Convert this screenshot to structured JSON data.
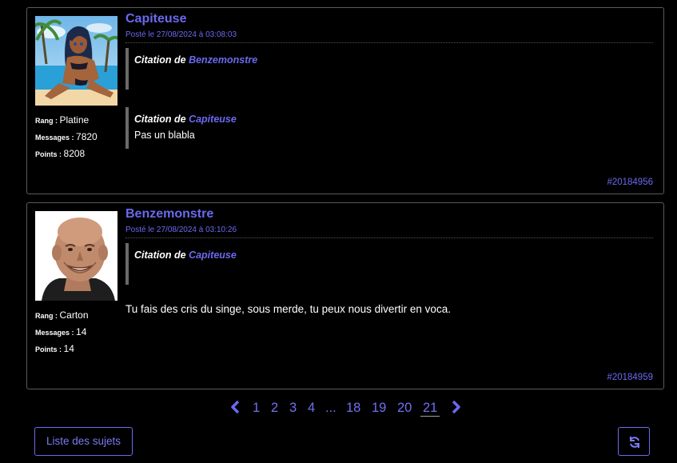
{
  "posts": [
    {
      "author": "Capiteuse",
      "date": "Posté le 27/08/2024 à 03:08:03",
      "stats": {
        "rank_label": "Rang",
        "rank": "Platine",
        "messages_label": "Messages",
        "messages": "7820",
        "points_label": "Points",
        "points": "8208"
      },
      "quotes": [
        {
          "prefix": "Citation de ",
          "author": "Benzemonstre",
          "text": ""
        },
        {
          "prefix": "Citation de ",
          "author": "Capiteuse",
          "text": "Pas un blabla"
        }
      ],
      "text": "",
      "id": "#20184956",
      "avatar_icon": "anime-girl-beach-avatar"
    },
    {
      "author": "Benzemonstre",
      "date": "Posté le 27/08/2024 à 03:10:26",
      "stats": {
        "rank_label": "Rang",
        "rank": "Carton",
        "messages_label": "Messages",
        "messages": "14",
        "points_label": "Points",
        "points": "14"
      },
      "quotes": [
        {
          "prefix": "Citation de ",
          "author": "Capiteuse",
          "text": ""
        }
      ],
      "text": "Tu fais des cris du singe, sous merde, tu peux nous divertir en voca.",
      "id": "#20184959",
      "avatar_icon": "bald-man-avatar"
    }
  ],
  "pagination": {
    "pages": [
      "1",
      "2",
      "3",
      "4",
      "...",
      "18",
      "19",
      "20",
      "21"
    ],
    "current": "21"
  },
  "buttons": {
    "topic_list": "Liste des sujets",
    "refresh_icon": "refresh-icon"
  },
  "colors": {
    "accent": "#6a6af0",
    "background": "#000000",
    "border": "#5a5a5a"
  }
}
